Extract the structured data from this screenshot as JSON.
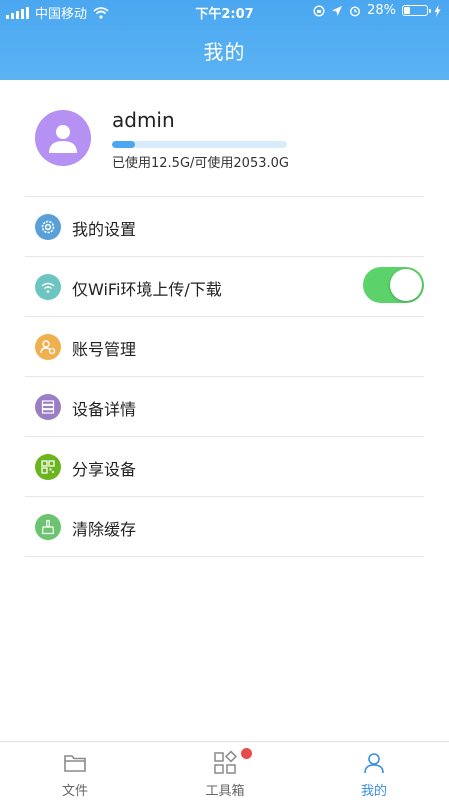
{
  "status_bar": {
    "carrier": "中国移动",
    "time": "下午2:07",
    "battery_percent": "28%",
    "battery_level": 0.28
  },
  "header": {
    "title": "我的"
  },
  "profile": {
    "username": "admin",
    "storage_text": "已使用12.5G/可使用2053.0G",
    "storage_used_fraction": 0.006
  },
  "menu": {
    "items": [
      {
        "label": "我的设置",
        "icon": "gear-icon",
        "color": "#5aa0d8"
      },
      {
        "label": "仅WiFi环境上传/下载",
        "icon": "wifi-icon",
        "color": "#6cc5c0",
        "toggle_on": true
      },
      {
        "label": "账号管理",
        "icon": "account-icon",
        "color": "#f0b050"
      },
      {
        "label": "设备详情",
        "icon": "server-icon",
        "color": "#9a7fc4"
      },
      {
        "label": "分享设备",
        "icon": "qrcode-icon",
        "color": "#6ab520"
      },
      {
        "label": "清除缓存",
        "icon": "broom-icon",
        "color": "#6cc470"
      }
    ]
  },
  "tabs": [
    {
      "label": "文件",
      "icon": "folder-icon"
    },
    {
      "label": "工具箱",
      "icon": "toolbox-icon",
      "has_badge": true
    },
    {
      "label": "我的",
      "icon": "user-icon",
      "active": true
    }
  ],
  "colors": {
    "primary": "#4aa7f0",
    "toggle_on": "#5bd36a",
    "avatar": "#b491f2",
    "badge": "#e74c4c"
  }
}
